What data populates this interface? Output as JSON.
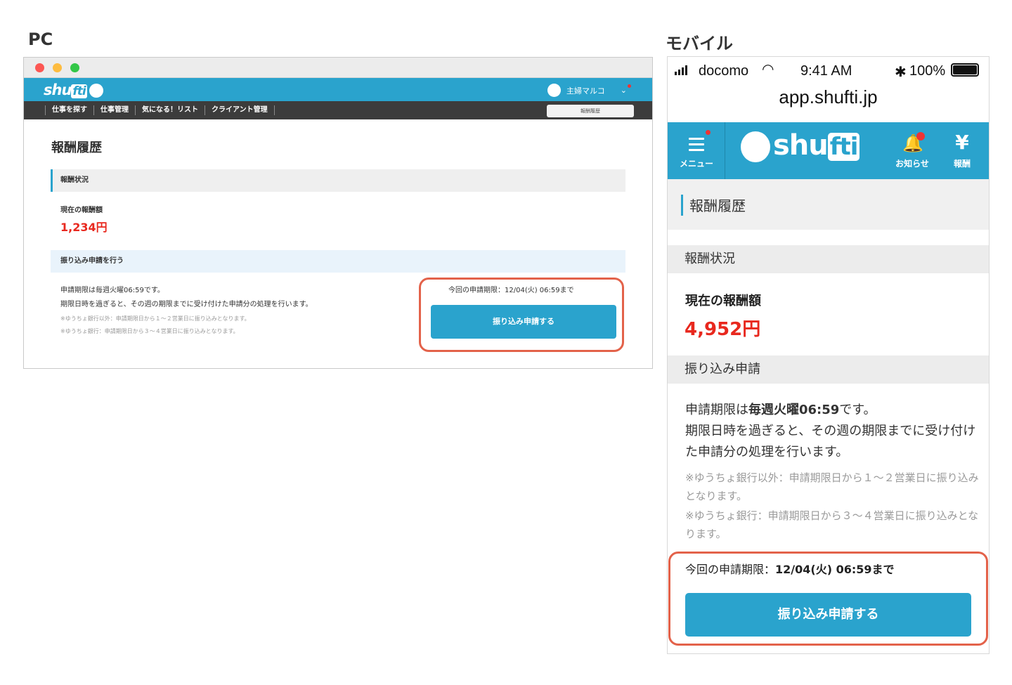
{
  "labels": {
    "pc": "PC",
    "mobile": "モバイル"
  },
  "pc": {
    "logo_pre": "shu",
    "logo_ft": "fti",
    "user_name": "主婦マルコ",
    "nav": [
      "仕事を探す",
      "仕事管理",
      "気になる！リスト",
      "クライアント管理"
    ],
    "nav_button": "報酬履歴",
    "page_title": "報酬履歴",
    "section_status": "報酬状況",
    "current_label": "現在の報酬額",
    "current_amount": "1,234円",
    "section_transfer": "振り込み申請を行う",
    "info_line1": "申請期限は毎週火曜06:59です。",
    "info_line2": "期限日時を過ぎると、その週の期限までに受け付けた申請分の処理を行います。",
    "note1": "※ゆうちょ銀行以外：申請期限日から１〜２営業日に振り込みとなります。",
    "note2": "※ゆうちょ銀行：申請期限日から３〜４営業日に振り込みとなります。",
    "deadline": "今回の申請期限：12/04(火) 06:59まで",
    "button": "振り込み申請する"
  },
  "mobile": {
    "carrier": "docomo",
    "time": "9:41 AM",
    "bluetooth": "✱",
    "battery": "100%",
    "url": "app.shufti.jp",
    "menu_label": "メニュー",
    "logo_pre": "shu",
    "logo_ft": "fti",
    "notif_label": "お知らせ",
    "reward_label": "報酬",
    "reward_symbol": "¥",
    "page_title": "報酬履歴",
    "section_status": "報酬状況",
    "current_label": "現在の報酬額",
    "current_amount": "4,952円",
    "section_transfer": "振り込み申請",
    "info_pre": "申請期限は",
    "info_bold": "毎週火曜06:59",
    "info_post": "です。",
    "info_line2": "期限日時を過ぎると、その週の期限までに受け付けた申請分の処理を行います。",
    "note1": "※ゆうちょ銀行以外：申請期限日から１〜２営業日に振り込みとなります。",
    "note2": "※ゆうちょ銀行：申請期限日から３〜４営業日に振り込みとなります。",
    "deadline_label": "今回の申請期限：",
    "deadline_value": "12/04(火) 06:59まで",
    "button": "振り込み申請する"
  },
  "colors": {
    "brand": "#2aa3cd",
    "amount": "#e8281e",
    "highlight": "#e3624a"
  }
}
